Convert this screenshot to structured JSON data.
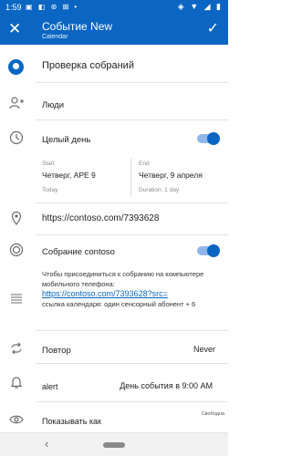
{
  "status": {
    "time": "1:59",
    "left_icons": "▣ ◧ ⊛ ⊠ •",
    "right_icons": "◈ ▼ ◢ ▮"
  },
  "appbar": {
    "title": "Событие New",
    "subtitle": "Calendar",
    "close_glyph": "✕",
    "save_glyph": "✓"
  },
  "event": {
    "title": "Проверка собраний"
  },
  "people": {
    "label": "Люди"
  },
  "allday": {
    "label": "Целый день",
    "on": true
  },
  "start": {
    "caption": "Start",
    "date": "Четверг, APE 9",
    "sub": "Today"
  },
  "end": {
    "caption": "End",
    "date": "Четверг, 9 апреля",
    "sub": "Duration: 1 day"
  },
  "location": {
    "value": "https://contoso.com/7393628"
  },
  "online": {
    "label": "Собрание contoso",
    "on": true
  },
  "description": {
    "line1": "Чтобы присоединиться к собранию на компьютере",
    "line2": "мобильного телефона:",
    "link": "https://contoso.com/7393628?src=",
    "line3": "ссылка календаря: один сенсорный абонент + 6"
  },
  "repeat": {
    "label": "Повтор",
    "value": "Never"
  },
  "alert": {
    "label": "alert",
    "value": "День события в 9:00 AM"
  },
  "show_as": {
    "label": "Показывать как",
    "value": "Свободна"
  },
  "icons": {
    "people": "user-plus-icon",
    "clock": "clock-icon",
    "location": "location-pin-icon",
    "online": "online-meeting-icon",
    "description": "description-lines-icon",
    "repeat": "repeat-icon",
    "alert": "bell-icon",
    "show_as": "eye-icon"
  },
  "colors": {
    "accent": "#0a66c2",
    "toggle_track": "#8fb6e6"
  },
  "navbar": {
    "back_glyph": "‹"
  }
}
